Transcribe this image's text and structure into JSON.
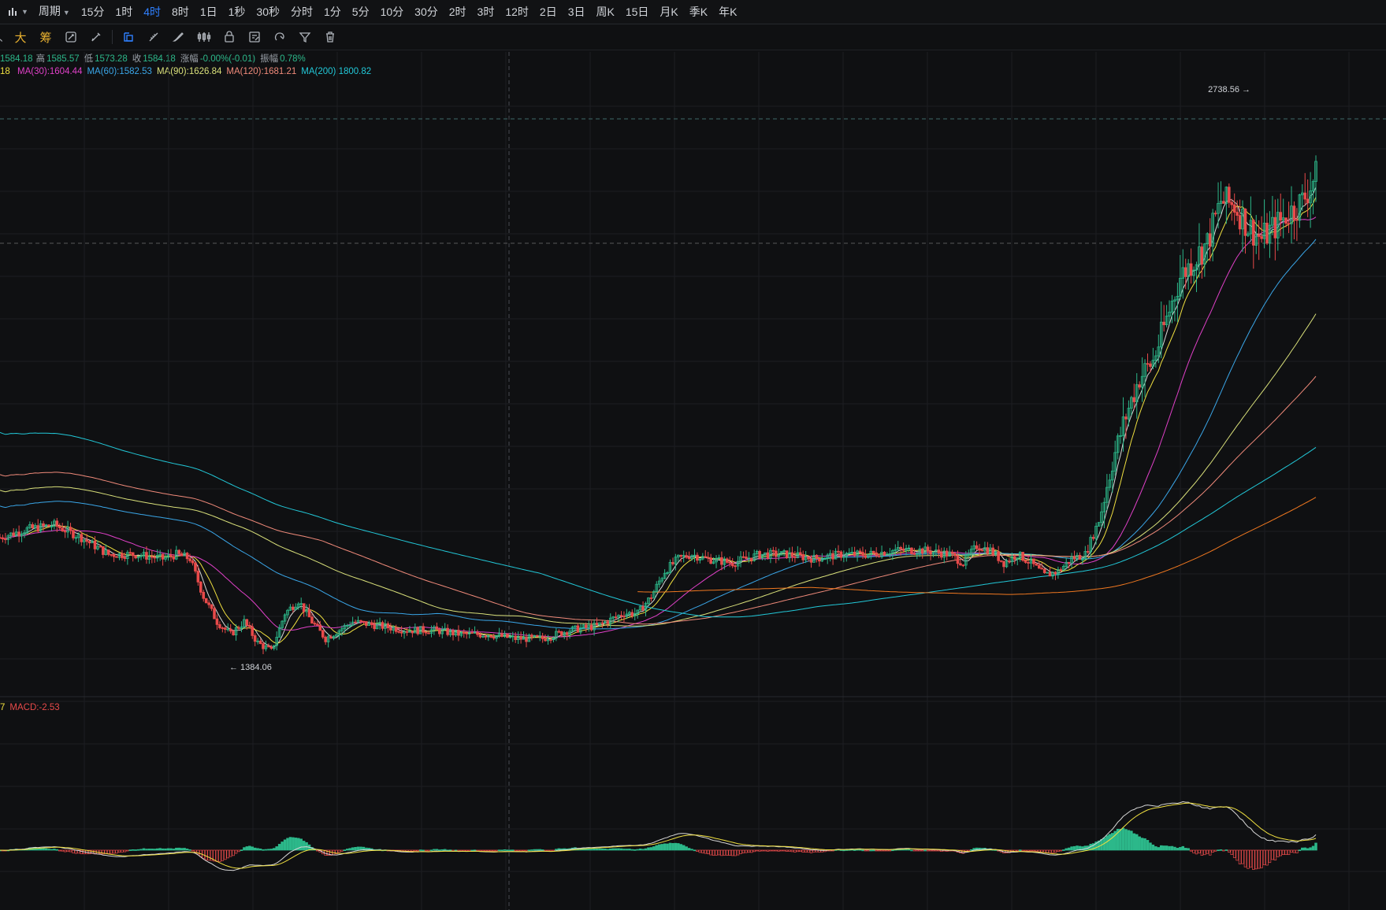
{
  "toolbar_top": {
    "period_label": "周期",
    "intervals": [
      "15分",
      "1时",
      "4时",
      "8时",
      "1日",
      "1秒",
      "30秒",
      "分时",
      "1分",
      "5分",
      "10分",
      "30分",
      "2时",
      "3时",
      "12时",
      "2日",
      "3日",
      "周K",
      "15日",
      "月K",
      "季K",
      "年K"
    ],
    "active_interval": "4时"
  },
  "toolbar_draw": {
    "text_tools": [
      "大",
      "筹"
    ]
  },
  "ohlc": {
    "open_value": "1584.18",
    "high_label": "高",
    "high_value": "1585.57",
    "low_label": "低",
    "low_value": "1573.28",
    "close_label": "收",
    "close_value": "1584.18",
    "change_label": "涨幅",
    "change_value": "-0.00%(-0.01)",
    "amplitude_label": "振幅",
    "amplitude_value": "0.78%"
  },
  "ma_legend": {
    "first_fragment": "18",
    "items": [
      {
        "text": "MA(30):1604.44",
        "color": "#e040c8"
      },
      {
        "text": "MA(60):1582.53",
        "color": "#3aa6e8"
      },
      {
        "text": "MA(90):1626.84",
        "color": "#d9e07a"
      },
      {
        "text": "MA(120):1681.21",
        "color": "#f08a7a"
      },
      {
        "text": "MA(200):1800.82",
        "color": "#22c8d8"
      }
    ]
  },
  "macd_legend": {
    "first_fragment": "7",
    "macd_text": "MACD:-2.53"
  },
  "colors": {
    "up": "#2cb88a",
    "down": "#e84a4a",
    "ma5": "#d8d8d8",
    "ma10": "#f0e040",
    "ma30": "#e040c8",
    "ma60": "#3aa6e8",
    "ma90": "#d9e07a",
    "ma120": "#f08a7a",
    "ma200": "#22c8d8",
    "ma_orange": "#f07820",
    "dif": "#d8d8d8",
    "dea": "#f0e040",
    "grid": "#1c1e22"
  },
  "chart_data": {
    "type": "candlestick",
    "title": "",
    "y_range": [
      1350,
      2800
    ],
    "annotations": [
      {
        "label": "2738.56",
        "type": "max_high"
      },
      {
        "label": "1384.06",
        "type": "min_low"
      }
    ],
    "price_path": [
      [
        0,
        1700
      ],
      [
        10,
        1720
      ],
      [
        20,
        1730
      ],
      [
        30,
        1700
      ],
      [
        40,
        1660
      ],
      [
        50,
        1660
      ],
      [
        60,
        1650
      ],
      [
        65,
        1660
      ],
      [
        70,
        1650
      ],
      [
        75,
        1560
      ],
      [
        80,
        1500
      ],
      [
        85,
        1470
      ],
      [
        90,
        1500
      ],
      [
        95,
        1450
      ],
      [
        100,
        1430
      ],
      [
        105,
        1520
      ],
      [
        110,
        1550
      ],
      [
        115,
        1500
      ],
      [
        120,
        1460
      ],
      [
        125,
        1480
      ],
      [
        130,
        1500
      ],
      [
        140,
        1490
      ],
      [
        150,
        1480
      ],
      [
        160,
        1480
      ],
      [
        170,
        1470
      ],
      [
        180,
        1470
      ],
      [
        190,
        1460
      ],
      [
        200,
        1460
      ],
      [
        210,
        1480
      ],
      [
        220,
        1490
      ],
      [
        230,
        1520
      ],
      [
        235,
        1520
      ],
      [
        240,
        1560
      ],
      [
        245,
        1620
      ],
      [
        250,
        1650
      ],
      [
        255,
        1660
      ],
      [
        260,
        1650
      ],
      [
        270,
        1640
      ],
      [
        280,
        1660
      ],
      [
        290,
        1660
      ],
      [
        300,
        1650
      ],
      [
        310,
        1660
      ],
      [
        320,
        1660
      ],
      [
        330,
        1670
      ],
      [
        340,
        1670
      ],
      [
        350,
        1660
      ],
      [
        355,
        1640
      ],
      [
        360,
        1680
      ],
      [
        365,
        1670
      ],
      [
        370,
        1640
      ],
      [
        375,
        1660
      ],
      [
        380,
        1640
      ],
      [
        385,
        1610
      ],
      [
        390,
        1620
      ],
      [
        395,
        1650
      ],
      [
        400,
        1660
      ],
      [
        405,
        1740
      ],
      [
        410,
        1880
      ],
      [
        415,
        1990
      ],
      [
        420,
        2080
      ],
      [
        425,
        2120
      ],
      [
        430,
        2220
      ],
      [
        435,
        2320
      ],
      [
        440,
        2360
      ],
      [
        445,
        2400
      ],
      [
        450,
        2500
      ],
      [
        455,
        2490
      ],
      [
        460,
        2440
      ],
      [
        465,
        2410
      ],
      [
        470,
        2440
      ],
      [
        475,
        2470
      ],
      [
        480,
        2500
      ],
      [
        485,
        2560
      ]
    ],
    "ma_series": [
      "MA5",
      "MA10",
      "MA30",
      "MA60",
      "MA90",
      "MA120",
      "MA200"
    ],
    "macd_hist_note": "MACD histogram + DIF/DEA lines in lower pane"
  }
}
